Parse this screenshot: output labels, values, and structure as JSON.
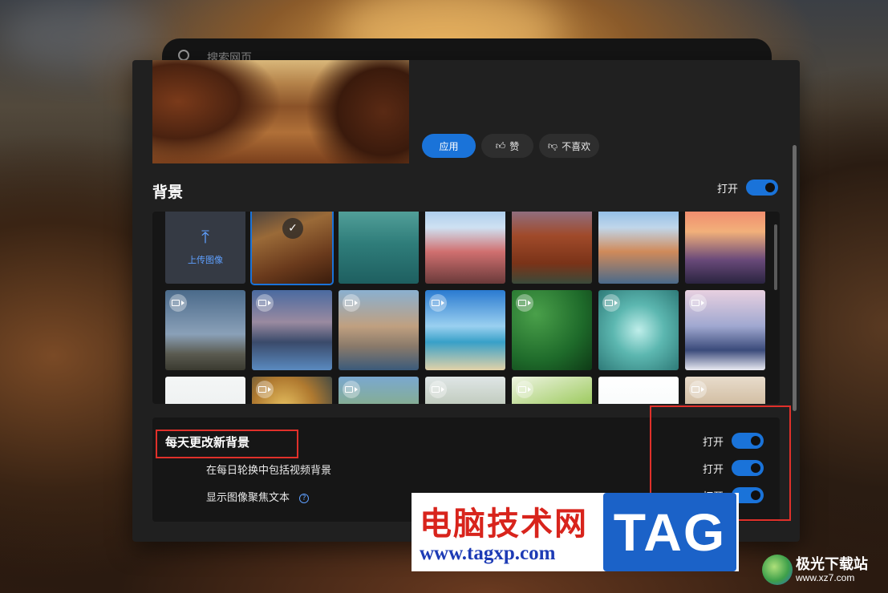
{
  "search": {
    "placeholder": "搜索网页"
  },
  "actions": {
    "apply": "应用",
    "like": "赞",
    "dislike": "不喜欢"
  },
  "background_section": {
    "title": "背景",
    "toggle_label": "打开",
    "toggle_on": true,
    "upload_label": "上传图像",
    "tiles": [
      {
        "kind": "upload"
      },
      {
        "kind": "image",
        "scene": "desert-rocks",
        "selected": true
      },
      {
        "kind": "image",
        "scene": "turquoise-sea"
      },
      {
        "kind": "image",
        "scene": "mount-fuji-pagoda"
      },
      {
        "kind": "image",
        "scene": "red-canyon-river"
      },
      {
        "kind": "image",
        "scene": "coastal-town"
      },
      {
        "kind": "image",
        "scene": "pier-sunset"
      },
      {
        "kind": "video",
        "scene": "mountain-dusk"
      },
      {
        "kind": "video",
        "scene": "city-skyline-water"
      },
      {
        "kind": "video",
        "scene": "island-village"
      },
      {
        "kind": "video",
        "scene": "beach-blue-sky"
      },
      {
        "kind": "video",
        "scene": "forest-aerial"
      },
      {
        "kind": "video",
        "scene": "water-droplet"
      },
      {
        "kind": "video",
        "scene": "santorini-sunset"
      },
      {
        "kind": "image",
        "scene": "white-texture"
      },
      {
        "kind": "video",
        "scene": "coral-reef"
      },
      {
        "kind": "video",
        "scene": "green-hills"
      },
      {
        "kind": "video",
        "scene": "misty-valley"
      },
      {
        "kind": "video",
        "scene": "ladybug-leaf"
      },
      {
        "kind": "image",
        "scene": "white-splash"
      },
      {
        "kind": "video",
        "scene": "sand-dunes"
      }
    ]
  },
  "daily_settings": {
    "main_label": "每天更改新背景",
    "main_toggle_label": "打开",
    "video_label": "在每日轮换中包括视频背景",
    "video_toggle_label": "打开",
    "focus_label": "显示图像聚焦文本",
    "focus_toggle_label": "打开",
    "help_icon": "?"
  },
  "watermark": {
    "title": "电脑技术网",
    "url": "www.tagxp.com",
    "tag": "TAG",
    "site_name": "极光下载站",
    "site_url": "www.xz7.com"
  },
  "colors": {
    "accent": "#1a73d9",
    "highlight_box": "#e0302a",
    "panel": "#202020"
  }
}
